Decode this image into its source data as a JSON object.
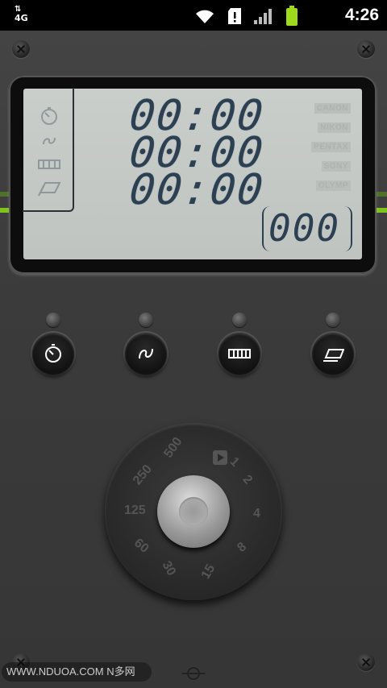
{
  "status_bar": {
    "network": "4G",
    "time": "4:26",
    "icons": [
      "wifi-icon",
      "sd-card-alert-icon",
      "signal-icon",
      "battery-icon"
    ]
  },
  "lcd": {
    "timers": [
      "00:00",
      "00:00",
      "00:00"
    ],
    "counter": "000",
    "brands": [
      "CANON",
      "NIKON",
      "PENTAX",
      "SONY",
      "OLYMP"
    ],
    "mode_icons": [
      "self-timer-icon",
      "interval-icon",
      "bulb-icon",
      "bracket-icon"
    ]
  },
  "buttons": [
    {
      "icon": "self-timer-icon"
    },
    {
      "icon": "interval-icon"
    },
    {
      "icon": "sequence-icon"
    },
    {
      "icon": "stack-icon"
    }
  ],
  "dial": {
    "numbers": [
      "500",
      "250",
      "125",
      "60",
      "30",
      "15",
      "8",
      "4",
      "2",
      "1"
    ]
  },
  "watermark": "WWW.NDUOA.COM N多网",
  "colors": {
    "lcd_bg": "#c4c9c5",
    "lcd_digits": "#2d4052",
    "accent_green": "#7fc41c"
  }
}
